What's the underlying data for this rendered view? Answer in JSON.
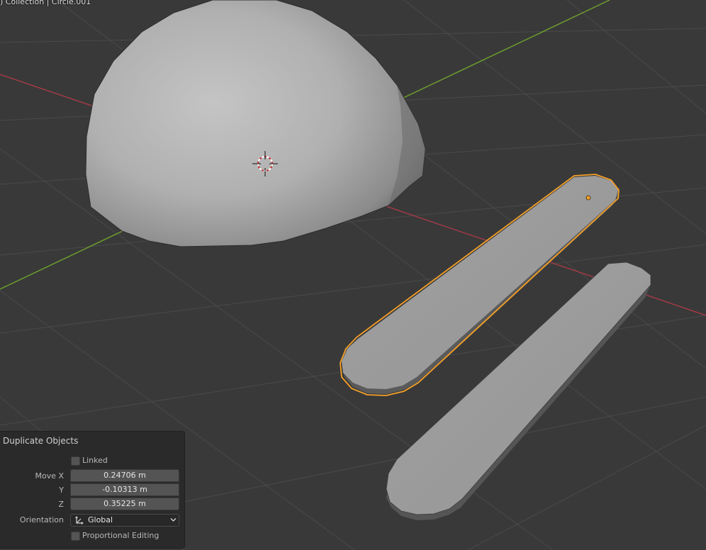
{
  "viewport": {
    "object_label": ") Collection | Circle.001"
  },
  "operator_panel": {
    "title": "Duplicate Objects",
    "linked_label": "Linked",
    "linked_checked": false,
    "move_label": "Move X",
    "y_label": "Y",
    "z_label": "Z",
    "move_x": "0.24706 m",
    "move_y": "-0.10313 m",
    "move_z": "0.35225 m",
    "orientation_label": "Orientation",
    "orientation_value": "Global",
    "proportional_label": "Proportional Editing",
    "proportional_checked": false
  },
  "icons": {
    "orientation": "transform-orientation-icon",
    "cursor": "3d-cursor-icon",
    "origin": "object-origin-icon"
  },
  "colors": {
    "background": "#393939",
    "x_axis": "#a03a46",
    "y_axis": "#6c9c2e",
    "selection_outline": "#f5a028",
    "panel_bg": "#2a2a2a",
    "field_bg": "#545454"
  }
}
